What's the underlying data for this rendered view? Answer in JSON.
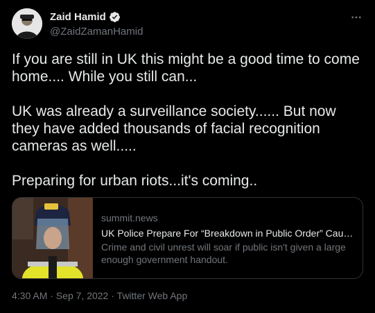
{
  "tweet": {
    "author": {
      "display_name": "Zaid Hamid",
      "handle": "@ZaidZamanHamid",
      "verified": true,
      "avatar_icon": "profile-photo"
    },
    "more_icon": "ellipsis-icon",
    "text": "If you are still in UK this might be a good time to come home.... While you still can...\n\nUK was already a surveillance society...... But now they have added thousands of facial recognition cameras as well.....\n\nPreparing for urban riots...it's coming..",
    "card": {
      "domain": "summit.news",
      "title": "UK Police Prepare For “Breakdown in Public Order” Caused...",
      "description": "Crime and civil unrest will soar if public isn't given a large enough government handout.",
      "thumbnail_icon": "police-officer-photo"
    },
    "meta": {
      "time": "4:30 AM",
      "separator": " · ",
      "date": "Sep 7, 2022",
      "source": "Twitter Web App"
    }
  },
  "colors": {
    "background": "#000000",
    "primary_text": "#e7e9ea",
    "secondary_text": "#71767b",
    "border": "#2f3336",
    "verified": "#e7e9ea"
  }
}
